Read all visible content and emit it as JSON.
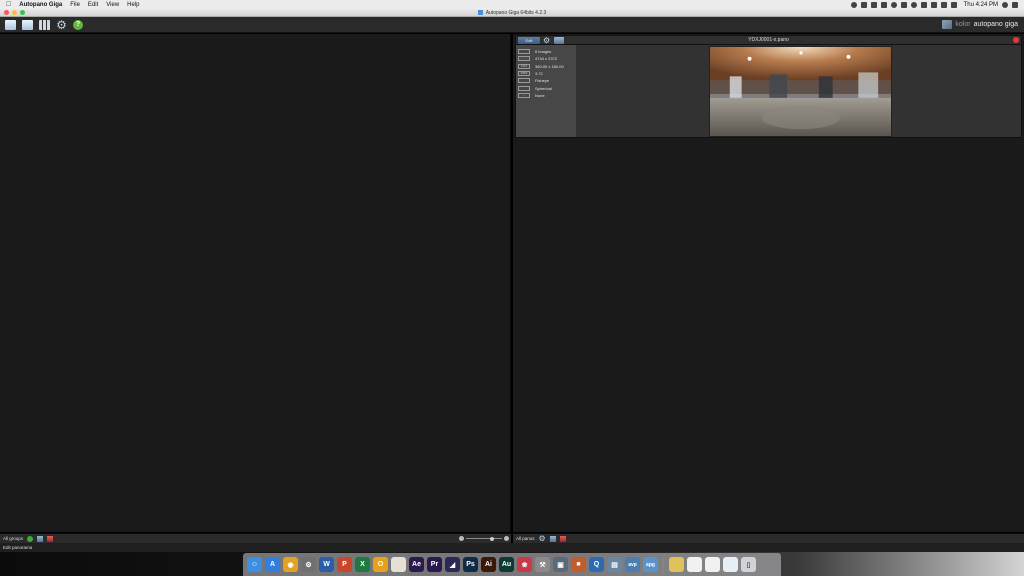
{
  "menubar": {
    "app_name": "Autopano Giga",
    "menus": [
      "File",
      "Edit",
      "View",
      "Help"
    ],
    "clock": "Thu 4:24 PM"
  },
  "window": {
    "title": "Autopano Giga 64bits 4.2.3"
  },
  "brand": {
    "kolor": "kolor",
    "name": "autopano giga"
  },
  "panorama": {
    "edit_label": "Edit",
    "title": "YDXJ0001-s.pano",
    "info": [
      {
        "icon": "images-icon",
        "icon_text": "",
        "text": "6 images"
      },
      {
        "icon": "size-icon",
        "icon_text": "←→",
        "text": "4744 x 2372"
      },
      {
        "icon": "fov-icon",
        "icon_text": "FOV",
        "text": "360.00 x 180.00"
      },
      {
        "icon": "rms-icon",
        "icon_text": "RMS",
        "text": "3.72"
      },
      {
        "icon": "lens-icon",
        "icon_text": "",
        "text": "Fisheye"
      },
      {
        "icon": "projection-icon",
        "icon_text": "",
        "text": "Spherical"
      },
      {
        "icon": "format-icon",
        "icon_text": "-·-",
        "text": "None"
      }
    ]
  },
  "left_bottom": {
    "label": "All groups"
  },
  "right_bottom": {
    "label": "All panos"
  },
  "status": {
    "text": "Edit panorama"
  },
  "dock": {
    "apps": [
      {
        "name": "finder",
        "color": "#3d8fe0",
        "glyph": "☺"
      },
      {
        "name": "app-store",
        "color": "#2f7fe0",
        "glyph": "A"
      },
      {
        "name": "chrome",
        "color": "#e2a322",
        "glyph": "◉"
      },
      {
        "name": "system-preferences",
        "color": "#707070",
        "glyph": "⚙"
      },
      {
        "name": "word",
        "color": "#2a5ea8",
        "glyph": "W"
      },
      {
        "name": "powerpoint",
        "color": "#c8462b",
        "glyph": "P"
      },
      {
        "name": "excel",
        "color": "#1f7a3f",
        "glyph": "X"
      },
      {
        "name": "outlook-o",
        "color": "#e8a21a",
        "glyph": "O"
      },
      {
        "name": "notes",
        "color": "#e5e0d6",
        "glyph": ""
      },
      {
        "name": "after-effects",
        "color": "#2c1a4f",
        "glyph": "Ae"
      },
      {
        "name": "premiere",
        "color": "#2c1a4f",
        "glyph": "Pr"
      },
      {
        "name": "media-encoder",
        "color": "#2a2a52",
        "glyph": "◢"
      },
      {
        "name": "photoshop",
        "color": "#0f2b45",
        "glyph": "Ps"
      },
      {
        "name": "illustrator",
        "color": "#3a1a07",
        "glyph": "Ai"
      },
      {
        "name": "audition",
        "color": "#0e3a33",
        "glyph": "Au"
      },
      {
        "name": "davinci",
        "color": "#c83a4a",
        "glyph": "❀"
      },
      {
        "name": "toolbox",
        "color": "#8a8a8a",
        "glyph": "⚒"
      },
      {
        "name": "image-capture",
        "color": "#5a6a7a",
        "glyph": "▣"
      },
      {
        "name": "books",
        "color": "#c45b2a",
        "glyph": "■"
      },
      {
        "name": "quicktime",
        "color": "#2d6bb0",
        "glyph": "Q"
      },
      {
        "name": "preview",
        "color": "#6b86a3",
        "glyph": "▤"
      },
      {
        "name": "autopano-video",
        "color": "#4a7eb0",
        "glyph": "avp"
      },
      {
        "name": "autopano-giga",
        "color": "#5b92c8",
        "glyph": "apg"
      },
      {
        "name": "folder-1",
        "color": "#e0c25a",
        "glyph": ""
      },
      {
        "name": "document-1",
        "color": "#f1f1f1",
        "glyph": ""
      },
      {
        "name": "document-2",
        "color": "#f1f1f1",
        "glyph": ""
      },
      {
        "name": "document-3",
        "color": "#e8eef6",
        "glyph": ""
      },
      {
        "name": "trash",
        "color": "#cfd4d9",
        "glyph": "▯"
      }
    ]
  }
}
